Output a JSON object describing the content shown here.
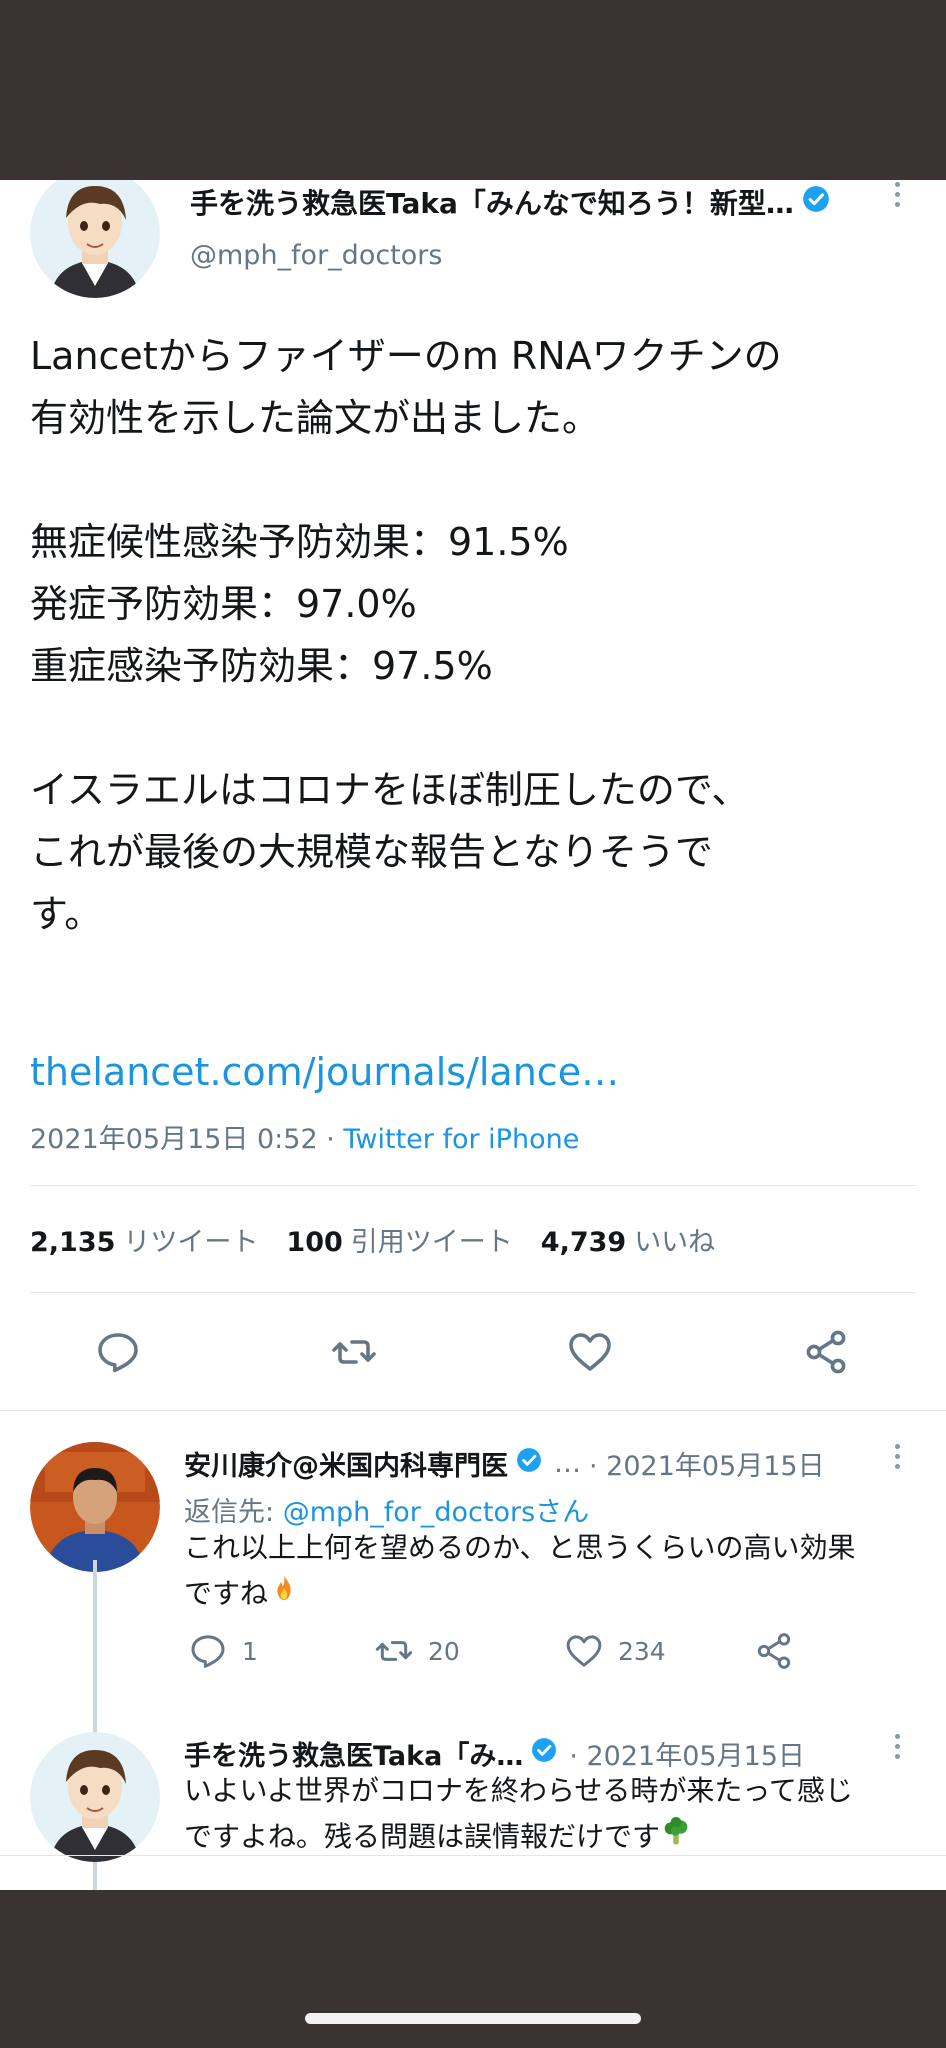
{
  "main_tweet": {
    "author_name": "手を洗う救急医Taka「みんなで知ろう！新型…",
    "handle": "@mph_for_doctors",
    "text_lines": [
      "Lancetからファイザーのm RNAワクチンの",
      "有効性を示した論文が出ました。",
      "",
      "無症候性感染予防効果：91.5%",
      "発症予防効果：97.0%",
      "重症感染予防効果：97.5%",
      "",
      "イスラエルはコロナをほぼ制圧したので、",
      "これが最後の大規模な報告となりそうで",
      "す。"
    ],
    "link": "thelancet.com/journals/lance…",
    "timestamp": "2021年05月15日 0:52",
    "separator": " · ",
    "client": "Twitter for iPhone",
    "stats": {
      "retweets_count": "2,135",
      "retweets_label": "リツイート",
      "quotes_count": "100",
      "quotes_label": "引用ツイート",
      "likes_count": "4,739",
      "likes_label": "いいね"
    }
  },
  "replies": [
    {
      "author_name": "安川康介@米国内科専門医",
      "ellipsis": "…",
      "date": "· 2021年05月15日",
      "reply_to_label": "返信先:",
      "reply_to_handle": "@mph_for_doctors",
      "reply_to_suffix": "さん",
      "text_line1": "これ以上上何を望めるのか、と思うくらいの高い効果",
      "text_line2": "ですね",
      "emoji": "fire-emoji",
      "reply_count": "1",
      "retweet_count": "20",
      "like_count": "234"
    },
    {
      "author_name": "手を洗う救急医Taka「み…",
      "date": "· 2021年05月15日",
      "text_line1": "いよいよ世界がコロナを終わらせる時が来たって感じ",
      "text_line2": "ですよね。残る問題は誤情報だけです",
      "emoji": "broccoli-emoji"
    }
  ],
  "colors": {
    "link_blue": "#1b95e0",
    "verified_blue": "#1da1f2",
    "gray_text": "#657786",
    "outer_dark": "#3a3331"
  }
}
